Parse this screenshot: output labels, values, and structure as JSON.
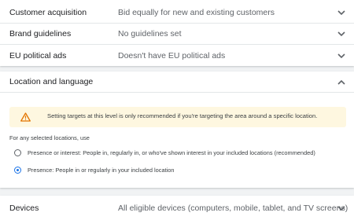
{
  "settings": [
    {
      "label": "Customer acquisition",
      "value": "Bid equally for new and existing customers"
    },
    {
      "label": "Brand guidelines",
      "value": "No guidelines set"
    },
    {
      "label": "EU political ads",
      "value": "Doesn't have EU political ads"
    }
  ],
  "location": {
    "title": "Location and language",
    "warning": "Setting targets at this level is only recommended if you're targeting the area around a specific location.",
    "subhead": "For any selected locations, use",
    "options": [
      {
        "label": "Presence or interest: People in, regularly in, or who've shown interest in your included locations (recommended)",
        "selected": false
      },
      {
        "label": "Presence: People in or regularly in your included location",
        "selected": true
      }
    ]
  },
  "devices": {
    "label": "Devices",
    "value": "All eligible devices (computers, mobile, tablet, and TV screens)"
  },
  "icons": {
    "expand": "chevron-down-icon",
    "collapse": "chevron-up-icon",
    "warning": "warning-icon"
  },
  "colors": {
    "accent": "#1a73e8",
    "warning_bg": "#fef7e0",
    "warning_icon": "#e37400"
  }
}
